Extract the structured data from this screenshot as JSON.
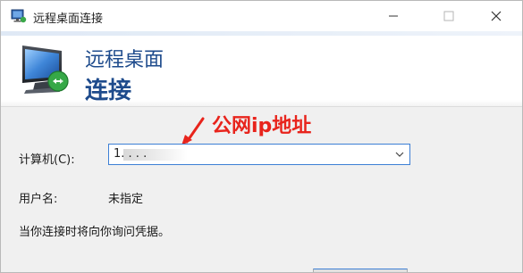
{
  "window": {
    "title": "远程桌面连接",
    "controls": {
      "minimize": "minimize-icon",
      "maximize": "maximize-icon",
      "close": "close-icon"
    }
  },
  "banner": {
    "line1": "远程桌面",
    "line2": "连接",
    "icon": "remote-desktop-monitor-icon"
  },
  "annotation": {
    "text": "公网ip地址",
    "color": "#e8241c"
  },
  "form": {
    "computer_label": "计算机(C):",
    "computer_value": "1. . . .",
    "user_label": "用户名:",
    "user_value": "未指定",
    "note": "当你连接时将向你询问凭据。"
  },
  "colors": {
    "banner_text": "#1e4b8c",
    "focus_border": "#3c7fd5"
  }
}
